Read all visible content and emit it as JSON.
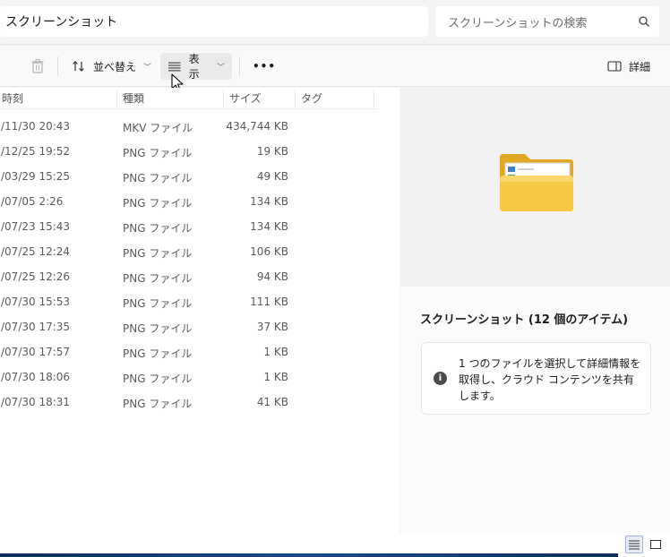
{
  "address": {
    "path": "スクリーンショット"
  },
  "search": {
    "placeholder": "スクリーンショットの検索"
  },
  "toolbar": {
    "sort_label": "並べ替え",
    "view_label": "表示",
    "more_label": "•••",
    "details_label": "詳細"
  },
  "columns": {
    "date": "時刻",
    "type": "種類",
    "size": "サイズ",
    "tag": "タグ"
  },
  "files": [
    {
      "date": "/11/30 20:43",
      "type": "MKV ファイル",
      "size": "434,744 KB"
    },
    {
      "date": "/12/25 19:52",
      "type": "PNG ファイル",
      "size": "19 KB"
    },
    {
      "date": "/03/29 15:25",
      "type": "PNG ファイル",
      "size": "49 KB"
    },
    {
      "date": "/07/05 2:26",
      "type": "PNG ファイル",
      "size": "134 KB"
    },
    {
      "date": "/07/23 15:43",
      "type": "PNG ファイル",
      "size": "134 KB"
    },
    {
      "date": "/07/25 12:24",
      "type": "PNG ファイル",
      "size": "106 KB"
    },
    {
      "date": "/07/25 12:26",
      "type": "PNG ファイル",
      "size": "94 KB"
    },
    {
      "date": "/07/30 15:53",
      "type": "PNG ファイル",
      "size": "111 KB"
    },
    {
      "date": "/07/30 17:35",
      "type": "PNG ファイル",
      "size": "37 KB"
    },
    {
      "date": "/07/30 17:57",
      "type": "PNG ファイル",
      "size": "1 KB"
    },
    {
      "date": "/07/30 18:06",
      "type": "PNG ファイル",
      "size": "1 KB"
    },
    {
      "date": "/07/30 18:31",
      "type": "PNG ファイル",
      "size": "41 KB"
    }
  ],
  "details": {
    "title": "スクリーンショット (12 個のアイテム)",
    "info_icon_label": "i",
    "info_text": "1 つのファイルを選択して詳細情報を取得し、クラウド コンテンツを共有します。"
  },
  "icons": {
    "delete": "trash-icon",
    "sort": "sort-arrows-icon",
    "view": "view-lines-icon",
    "details": "details-pane-icon",
    "search": "search-icon",
    "folder": "folder-icon",
    "info": "info-icon"
  },
  "colors": {
    "accent": "#0067c0",
    "folder": "#f6c945"
  }
}
